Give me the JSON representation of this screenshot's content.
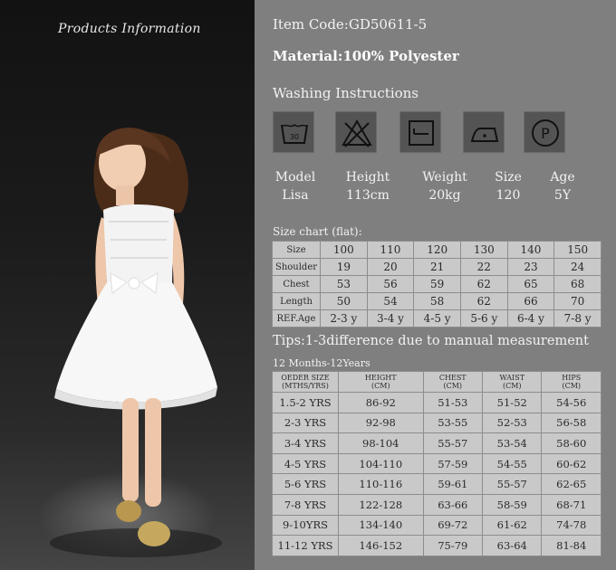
{
  "photo": {
    "title": "Products Information"
  },
  "item_code": "Item Code:GD50611-5",
  "material": "Material:100% Polyester",
  "washing_title": "Washing Instructions",
  "washing_icons": [
    "wash-30-icon",
    "no-bleach-icon",
    "tumble-dry-icon",
    "iron-low-icon",
    "dry-clean-p-icon"
  ],
  "specs": {
    "labels": [
      "Model",
      "Height",
      "Weight",
      "Size",
      "Age"
    ],
    "values": [
      "Lisa",
      "113cm",
      "20kg",
      "120",
      "5Y"
    ]
  },
  "size_chart": {
    "title": "Size chart (flat):",
    "rows": [
      [
        "Size",
        "100",
        "110",
        "120",
        "130",
        "140",
        "150"
      ],
      [
        "Shoulder",
        "19",
        "20",
        "21",
        "22",
        "23",
        "24"
      ],
      [
        "Chest",
        "53",
        "56",
        "59",
        "62",
        "65",
        "68"
      ],
      [
        "Length",
        "50",
        "54",
        "58",
        "62",
        "66",
        "70"
      ],
      [
        "REF.Age",
        "2-3 y",
        "3-4 y",
        "4-5 y",
        "5-6 y",
        "6-4 y",
        "7-8 y"
      ]
    ]
  },
  "tips": "Tips:1-3difference due to manual measurement",
  "months_title": "12 Months-12Years",
  "measure_table": {
    "headers": [
      [
        "OEDER SIZE",
        "(MTHS/YRS)"
      ],
      [
        "HEIGHT",
        "(CM)"
      ],
      [
        "CHEST",
        "(CM)"
      ],
      [
        "WAIST",
        "(CM)"
      ],
      [
        "HIPS",
        "(CM)"
      ]
    ],
    "rows": [
      [
        "1.5-2 YRS",
        "86-92",
        "51-53",
        "51-52",
        "54-56"
      ],
      [
        "2-3 YRS",
        "92-98",
        "53-55",
        "52-53",
        "56-58"
      ],
      [
        "3-4 YRS",
        "98-104",
        "55-57",
        "53-54",
        "58-60"
      ],
      [
        "4-5 YRS",
        "104-110",
        "57-59",
        "54-55",
        "60-62"
      ],
      [
        "5-6 YRS",
        "110-116",
        "59-61",
        "55-57",
        "62-65"
      ],
      [
        "7-8 YRS",
        "122-128",
        "63-66",
        "58-59",
        "68-71"
      ],
      [
        "9-10YRS",
        "134-140",
        "69-72",
        "61-62",
        "74-78"
      ],
      [
        "11-12 YRS",
        "146-152",
        "75-79",
        "63-64",
        "81-84"
      ]
    ]
  }
}
